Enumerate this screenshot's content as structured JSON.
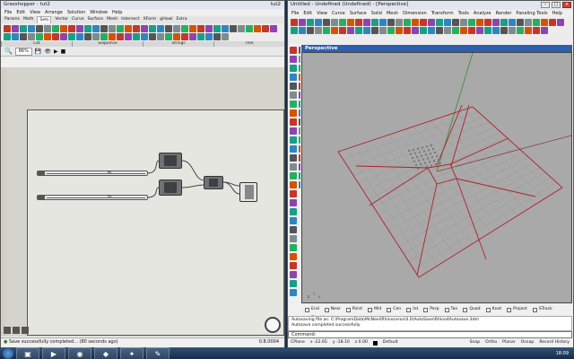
{
  "grasshopper": {
    "title": "Grasshopper - tut2",
    "doc_tab": "tut2",
    "menu": [
      "File",
      "Edit",
      "View",
      "Arrange",
      "Solution",
      "Window",
      "Help"
    ],
    "tabs": [
      "Params",
      "Math",
      "Sets",
      "Vector",
      "Curve",
      "Surface",
      "Mesh",
      "Intersect",
      "XForm",
      "gHowl",
      "Extra"
    ],
    "active_tab": "Sets",
    "sections": [
      "List",
      "Sequence",
      "Strings",
      "Tree"
    ],
    "zoom": "86%",
    "sliders": [
      {
        "label": "n",
        "value": "80"
      },
      {
        "label": "m",
        "value": "55"
      }
    ],
    "status_message": "Save successfully completed... (80 seconds ago)",
    "version": "0.8.0004"
  },
  "rhino": {
    "title": "Untitled - Undefined (Undefined) - [Perspective]",
    "menu": [
      "File",
      "Edit",
      "View",
      "Curve",
      "Surface",
      "Solid",
      "Mesh",
      "Dimension",
      "Transform",
      "Tools",
      "Analyze",
      "Render",
      "Paneling Tools",
      "Help"
    ],
    "viewport_title": "Perspective",
    "osnaps": [
      {
        "label": "End",
        "checked": false
      },
      {
        "label": "Near",
        "checked": false
      },
      {
        "label": "Point",
        "checked": false
      },
      {
        "label": "Mid",
        "checked": false
      },
      {
        "label": "Cen",
        "checked": false
      },
      {
        "label": "Int",
        "checked": false
      },
      {
        "label": "Perp",
        "checked": false
      },
      {
        "label": "Tan",
        "checked": false
      },
      {
        "label": "Quad",
        "checked": false
      },
      {
        "label": "Knot",
        "checked": false
      },
      {
        "label": "Project",
        "checked": false
      },
      {
        "label": "STrack",
        "checked": false
      },
      {
        "label": "Disable",
        "checked": false
      }
    ],
    "history": [
      "Autosaving file as: C:\\ProgramData\\McNeel\\Rhinoceros\\4.0\\AutoSave\\Rhino4Autosave.3dm",
      "Autosave completed successfully"
    ],
    "command_label": "Command:",
    "status": {
      "cplane": "CPlane",
      "x": "x -22.65",
      "y": "y -18.10",
      "z": "z 0.00",
      "layer": "Default",
      "toggles": [
        "Snap",
        "Ortho",
        "Planar",
        "Osnap",
        "Record History"
      ]
    }
  },
  "taskbar": {
    "clock": "18:09"
  },
  "colors": {
    "accent_blue": "#2e5fae",
    "curve_red": "#b0202a",
    "viewport_gray": "#a9a9a9",
    "desktop": "#1b2f48"
  }
}
